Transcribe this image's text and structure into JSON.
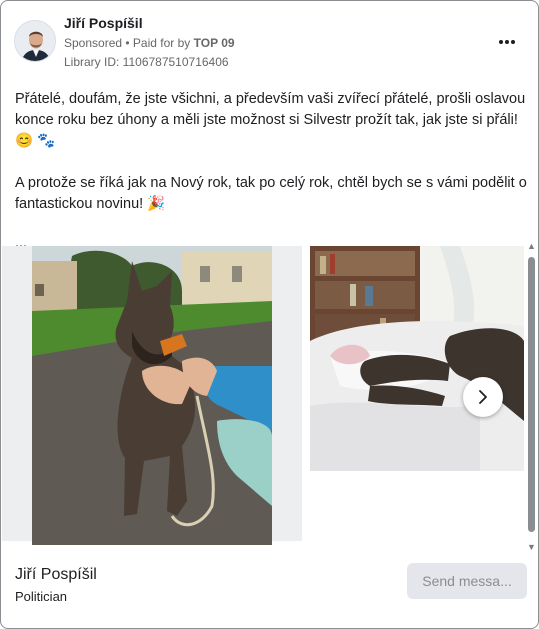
{
  "ad": {
    "author": "Jiří Pospíšil",
    "sponsored": "Sponsored",
    "paid_prefix": " • Paid for by ",
    "paid_by": "TOP 09",
    "library_id": "Library ID: 1106787510716406"
  },
  "post": {
    "paragraph1": "Přátelé, doufám, že jste všichni, a především vaši zvířecí přátelé, prošli oslavou konce roku bez úhony a měli jste možnost si Silvestr prožít tak, jak jste si přáli! 😊 🐾",
    "paragraph2": "A protože se říká jak na Nový rok, tak po celý rok, chtěl bych se s vámi podělit o fantastickou novinu! 🎉",
    "more": "..."
  },
  "carousel": {
    "slides": [
      "dog-on-leash-photo",
      "dog-sleeping-on-bed-photo"
    ],
    "next_icon": "chevron-right-icon"
  },
  "footer": {
    "name": "Jiří Pospíšil",
    "role": "Politician",
    "cta": "Send messa..."
  },
  "colors": {
    "text": "#1c1e21",
    "secondary": "#65676b",
    "button_bg": "#e4e6eb",
    "button_text": "#8a8d91"
  }
}
